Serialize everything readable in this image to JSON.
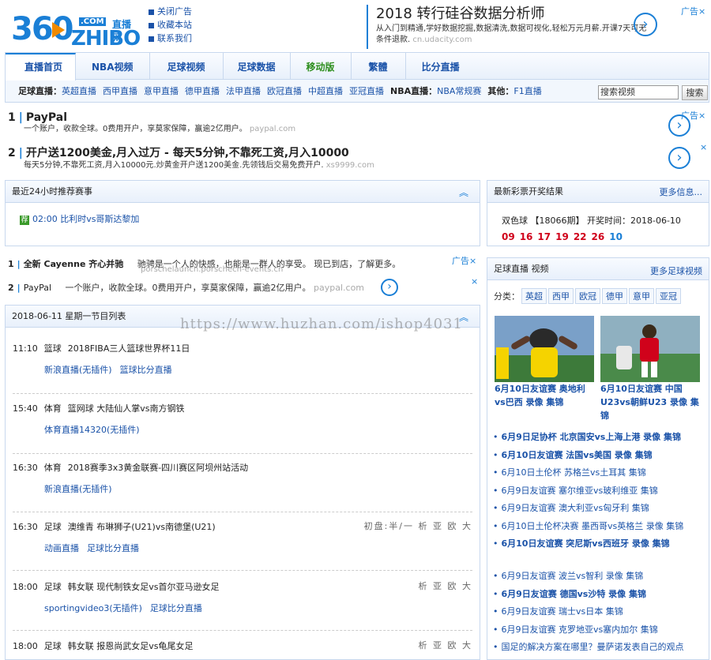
{
  "logo": {
    "n360": "360",
    "com": ".COM",
    "zhibo": "ZHIBO",
    "zbw": "直播网"
  },
  "toplinks": [
    "关闭广告",
    "收藏本站",
    "联系我们"
  ],
  "topad": {
    "title": "2018 转行硅谷数据分析师",
    "desc": "从入门到精通,学好数据挖掘,数据清洗,数据可视化,轻松万元月薪.开课7天可无条件退款.",
    "url": "cn.udacity.com",
    "adlabel": "广告",
    "close": "×"
  },
  "nav": {
    "tabs": [
      "直播首页",
      "NBA视频",
      "足球视频",
      "足球数据",
      "移动版",
      "繁體",
      "比分直播"
    ],
    "football_label": "足球直播：",
    "football_links": [
      "英超直播",
      "西甲直播",
      "意甲直播",
      "德甲直播",
      "法甲直播",
      "欧冠直播",
      "中超直播",
      "亚冠直播"
    ],
    "nba_label": "NBA直播：",
    "nba_links": [
      "NBA常规赛"
    ],
    "other_label": "其他：",
    "other_links": [
      "F1直播"
    ],
    "search_value": "搜索视频",
    "search_btn": "搜索"
  },
  "textads": [
    {
      "num": "1",
      "title": "PayPal",
      "desc": "一个账户，收款全球。0费用开户，享莫家保障，赢逾2亿用户。",
      "url": "paypal.com"
    },
    {
      "num": "2",
      "title": "开户送1200美金,月入过万 - 每天5分钟,不靠死工资,月入10000",
      "desc": "每天5分钟,不靠死工资,月入10000元.炒黄金开户送1200美金.先领钱后交易免费开户.",
      "url": "xs9999.com"
    }
  ],
  "recommend": {
    "title": "最近24小时推荐赛事",
    "badge": "荐",
    "item": "02:00 比利时vs哥斯达黎加"
  },
  "midads": [
    {
      "num": "1",
      "title": "全新 Cayenne 齐心并驰",
      "desc": "驰骋是一个人的快感，也能是一群人的享受。 现已到店，了解更多。",
      "url": "porschelaunch.porschecn-events.cn"
    },
    {
      "num": "2",
      "title": "PayPal",
      "desc": "一个账户，收款全球。0费用开户，享莫家保障，赢逾2亿用户。",
      "url": "paypal.com"
    }
  ],
  "schedule": {
    "title": "2018-06-11 星期一节目列表",
    "rows": [
      {
        "time": "11:10",
        "cat": "篮球",
        "name": "2018FIBA三人篮球世界杯11日",
        "links": [
          "新浪直播(无插件)",
          "篮球比分直播"
        ],
        "odds": ""
      },
      {
        "time": "15:40",
        "cat": "体育",
        "name": "篮网球 大陆仙人掌vs南方钢铁",
        "links": [
          "体育直播14320(无插件)"
        ],
        "odds": ""
      },
      {
        "time": "16:30",
        "cat": "体育",
        "name": "2018赛季3x3黄金联赛-四川赛区阿坝州站活动",
        "links": [
          "新浪直播(无插件)"
        ],
        "odds": ""
      },
      {
        "time": "16:30",
        "cat": "足球",
        "name": "澳维青 布琳狮子(U21)vs南德堡(U21)",
        "links": [
          "动画直播",
          "足球比分直播"
        ],
        "odds": "初盘:半/一  析 亚 欧 大"
      },
      {
        "time": "18:00",
        "cat": "足球",
        "name": "韩女联 现代制铁女足vs首尔亚马逊女足",
        "links": [
          "sportingvideo3(无插件)",
          "足球比分直播"
        ],
        "odds": "析 亚 欧 大"
      },
      {
        "time": "18:00",
        "cat": "足球",
        "name": "韩女联 报恩尚武女足vs龟尾女足",
        "links": [],
        "odds": "析 亚 欧 大"
      }
    ]
  },
  "lottery": {
    "title": "最新彩票开奖结果",
    "more": "更多信息...",
    "line": "双色球 【18066期】 开奖时间：2018-06-10",
    "red": [
      "09",
      "16",
      "17",
      "19",
      "22",
      "26"
    ],
    "blue": "10"
  },
  "video": {
    "title": "足球直播 视频",
    "more": "更多足球视频",
    "cat_label": "分类：",
    "cats": [
      "英超",
      "西甲",
      "欧冠",
      "德甲",
      "意甲",
      "亚冠"
    ],
    "thumbs": [
      {
        "caption": "6月10日友谊赛 奥地利vs巴西 录像 集锦"
      },
      {
        "caption": "6月10日友谊赛 中国U23vs朝鲜U23 录像 集锦"
      }
    ],
    "list1": [
      {
        "text": "6月9日足协杯 北京国安vs上海上港 录像 集锦",
        "bold": true
      },
      {
        "text": "6月10日友谊赛 法国vs美国 录像 集锦",
        "bold": true
      },
      {
        "text": "6月10日土伦杯 苏格兰vs土耳其 集锦",
        "bold": false
      },
      {
        "text": "6月9日友谊赛 塞尔维亚vs玻利维亚 集锦",
        "bold": false
      },
      {
        "text": "6月9日友谊赛 澳大利亚vs匈牙利 集锦",
        "bold": false
      },
      {
        "text": "6月10日土伦杯决赛 墨西哥vs英格兰 录像 集锦",
        "bold": false
      },
      {
        "text": "6月10日友谊赛 突尼斯vs西班牙 录像 集锦",
        "bold": true
      }
    ],
    "list2": [
      {
        "text": "6月9日友谊赛 波兰vs智利 录像 集锦",
        "bold": false
      },
      {
        "text": "6月9日友谊赛 德国vs沙特 录像 集锦",
        "bold": true
      },
      {
        "text": "6月9日友谊赛 瑞士vs日本 集锦",
        "bold": false
      },
      {
        "text": "6月9日友谊赛 克罗地亚vs塞内加尔 集锦",
        "bold": false
      },
      {
        "text": "国足的解决方案在哪里？曼萨诺发表自己的观点",
        "bold": false
      }
    ]
  },
  "watermark": "https://www.huzhan.com/ishop4031",
  "colors": {
    "accent": "#1a7fd6",
    "link": "#1a52a8",
    "red": "#d0021b",
    "green": "#3a9a2a"
  }
}
